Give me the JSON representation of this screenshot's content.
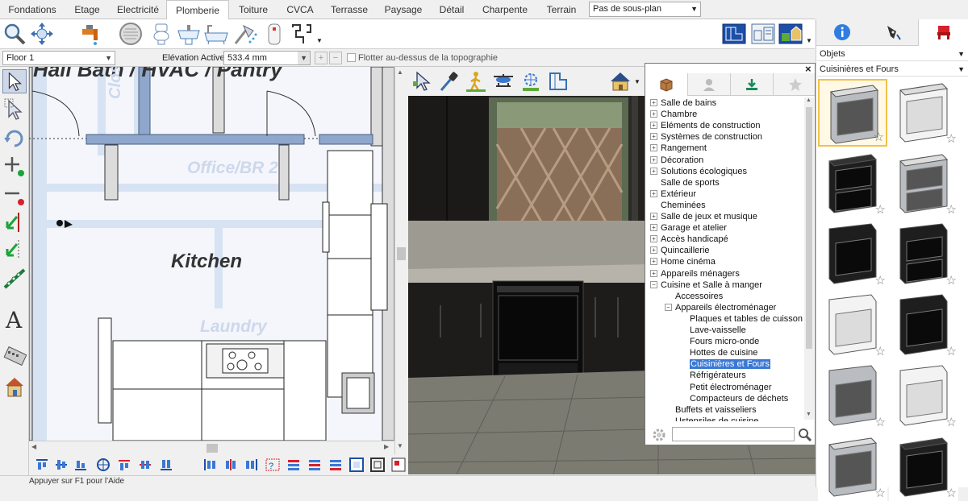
{
  "tabs": [
    {
      "label": "Fondations",
      "active": false
    },
    {
      "label": "Etage",
      "active": false
    },
    {
      "label": "Electricité",
      "active": false
    },
    {
      "label": "Plomberie",
      "active": true
    },
    {
      "label": "Toiture",
      "active": false
    },
    {
      "label": "CVCA",
      "active": false
    },
    {
      "label": "Terrasse",
      "active": false
    },
    {
      "label": "Paysage",
      "active": false
    },
    {
      "label": "Détail",
      "active": false
    },
    {
      "label": "Charpente",
      "active": false
    },
    {
      "label": "Terrain",
      "active": false
    }
  ],
  "plan_select": {
    "value": "Pas de sous-plan"
  },
  "options_bar": {
    "floor": "Floor 1",
    "elevation_label": "Elévation Active:",
    "elevation_value": "533.4 mm",
    "plus_label": "+",
    "minus_label": "−",
    "float_label": "Flotter au-dessus de la topographie"
  },
  "plan": {
    "rooms": {
      "top_partial": "Hall Bath / HVAC / Pantry",
      "office": "Office/BR 2",
      "kitchen": "Kitchen",
      "laundry": "Laundry",
      "closet": "Closet"
    }
  },
  "library": {
    "close_label": "×",
    "tree": [
      {
        "label": "Salle de bains",
        "level": 0,
        "expander": "+"
      },
      {
        "label": "Chambre",
        "level": 0,
        "expander": "+"
      },
      {
        "label": "Eléments de construction",
        "level": 0,
        "expander": "+"
      },
      {
        "label": "Systèmes de construction",
        "level": 0,
        "expander": "+"
      },
      {
        "label": "Rangement",
        "level": 0,
        "expander": "+"
      },
      {
        "label": "Décoration",
        "level": 0,
        "expander": "+"
      },
      {
        "label": "Solutions écologiques",
        "level": 0,
        "expander": "+"
      },
      {
        "label": "Salle de sports",
        "level": 0,
        "expander": ""
      },
      {
        "label": "Extérieur",
        "level": 0,
        "expander": "+"
      },
      {
        "label": "Cheminées",
        "level": 0,
        "expander": ""
      },
      {
        "label": "Salle de jeux et musique",
        "level": 0,
        "expander": "+"
      },
      {
        "label": "Garage et atelier",
        "level": 0,
        "expander": "+"
      },
      {
        "label": "Accès handicapé",
        "level": 0,
        "expander": "+"
      },
      {
        "label": "Quincaillerie",
        "level": 0,
        "expander": "+"
      },
      {
        "label": "Home cinéma",
        "level": 0,
        "expander": "+"
      },
      {
        "label": "Appareils ménagers",
        "level": 0,
        "expander": "+"
      },
      {
        "label": "Cuisine et Salle à manger",
        "level": 0,
        "expander": "−"
      },
      {
        "label": "Accessoires",
        "level": 1,
        "expander": ""
      },
      {
        "label": "Appareils électroménager",
        "level": 1,
        "expander": "−"
      },
      {
        "label": "Plaques et tables de cuisson",
        "level": 2,
        "expander": ""
      },
      {
        "label": "Lave-vaisselle",
        "level": 2,
        "expander": ""
      },
      {
        "label": "Fours micro-onde",
        "level": 2,
        "expander": ""
      },
      {
        "label": "Hottes de cuisine",
        "level": 2,
        "expander": ""
      },
      {
        "label": "Cuisinières et Fours",
        "level": 2,
        "expander": "",
        "selected": true
      },
      {
        "label": "Réfrigérateurs",
        "level": 2,
        "expander": ""
      },
      {
        "label": "Petit électroménager",
        "level": 2,
        "expander": ""
      },
      {
        "label": "Compacteurs de déchets",
        "level": 2,
        "expander": ""
      },
      {
        "label": "Buffets et vaisseliers",
        "level": 1,
        "expander": ""
      },
      {
        "label": "Ustensiles de cuisine",
        "level": 1,
        "expander": ""
      }
    ],
    "search_placeholder": ""
  },
  "catalog": {
    "filter": "Objets",
    "category": "Cuisinières et Fours",
    "star": "☆"
  },
  "status": {
    "text": "Appuyer sur F1 pour l'Aide"
  }
}
